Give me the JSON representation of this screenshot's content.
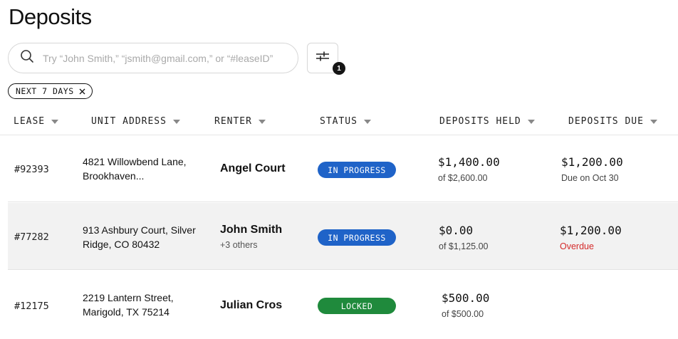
{
  "page": {
    "title": "Deposits"
  },
  "search": {
    "placeholder": "Try “John Smith,” “jsmith@gmail.com,” or “#leaseID”"
  },
  "filter": {
    "badge_count": "1"
  },
  "chips": [
    {
      "label": "NEXT 7 DAYS"
    }
  ],
  "table": {
    "columns": [
      "LEASE",
      "UNIT ADDRESS",
      "RENTER",
      "STATUS",
      "DEPOSITS HELD",
      "DEPOSITS DUE"
    ],
    "rows": [
      {
        "lease": "#92393",
        "address_line1": "4821 Willowbend Lane,",
        "address_line2": "Brookhaven...",
        "renter": "Angel Court",
        "renter_sub": "",
        "status": "IN PROGRESS",
        "held": "$1,400.00",
        "held_sub": "of $2,600.00",
        "due": "$1,200.00",
        "due_sub": "Due on Oct 30"
      },
      {
        "lease": "#77282",
        "address_line1": "913 Ashbury Court, Silver",
        "address_line2": "Ridge, CO 80432",
        "renter": "John Smith",
        "renter_sub": "+3 others",
        "status": "IN PROGRESS",
        "held": "$0.00",
        "held_sub": "of $1,125.00",
        "due": "$1,200.00",
        "due_sub": "Overdue"
      },
      {
        "lease": "#12175",
        "address_line1": "2219 Lantern Street,",
        "address_line2": "Marigold, TX 75214",
        "renter": "Julian Cros",
        "renter_sub": "",
        "status": "LOCKED",
        "held": "$500.00",
        "held_sub": "of $500.00",
        "due": "",
        "due_sub": ""
      }
    ]
  },
  "colors": {
    "status_in_progress": "#1f63c8",
    "status_locked": "#1f8a3c",
    "overdue": "#d42a2a"
  },
  "icons": {
    "search": "search-icon",
    "filter": "sliders-icon",
    "chip_close": "close-icon",
    "sort": "caret-down-icon"
  }
}
